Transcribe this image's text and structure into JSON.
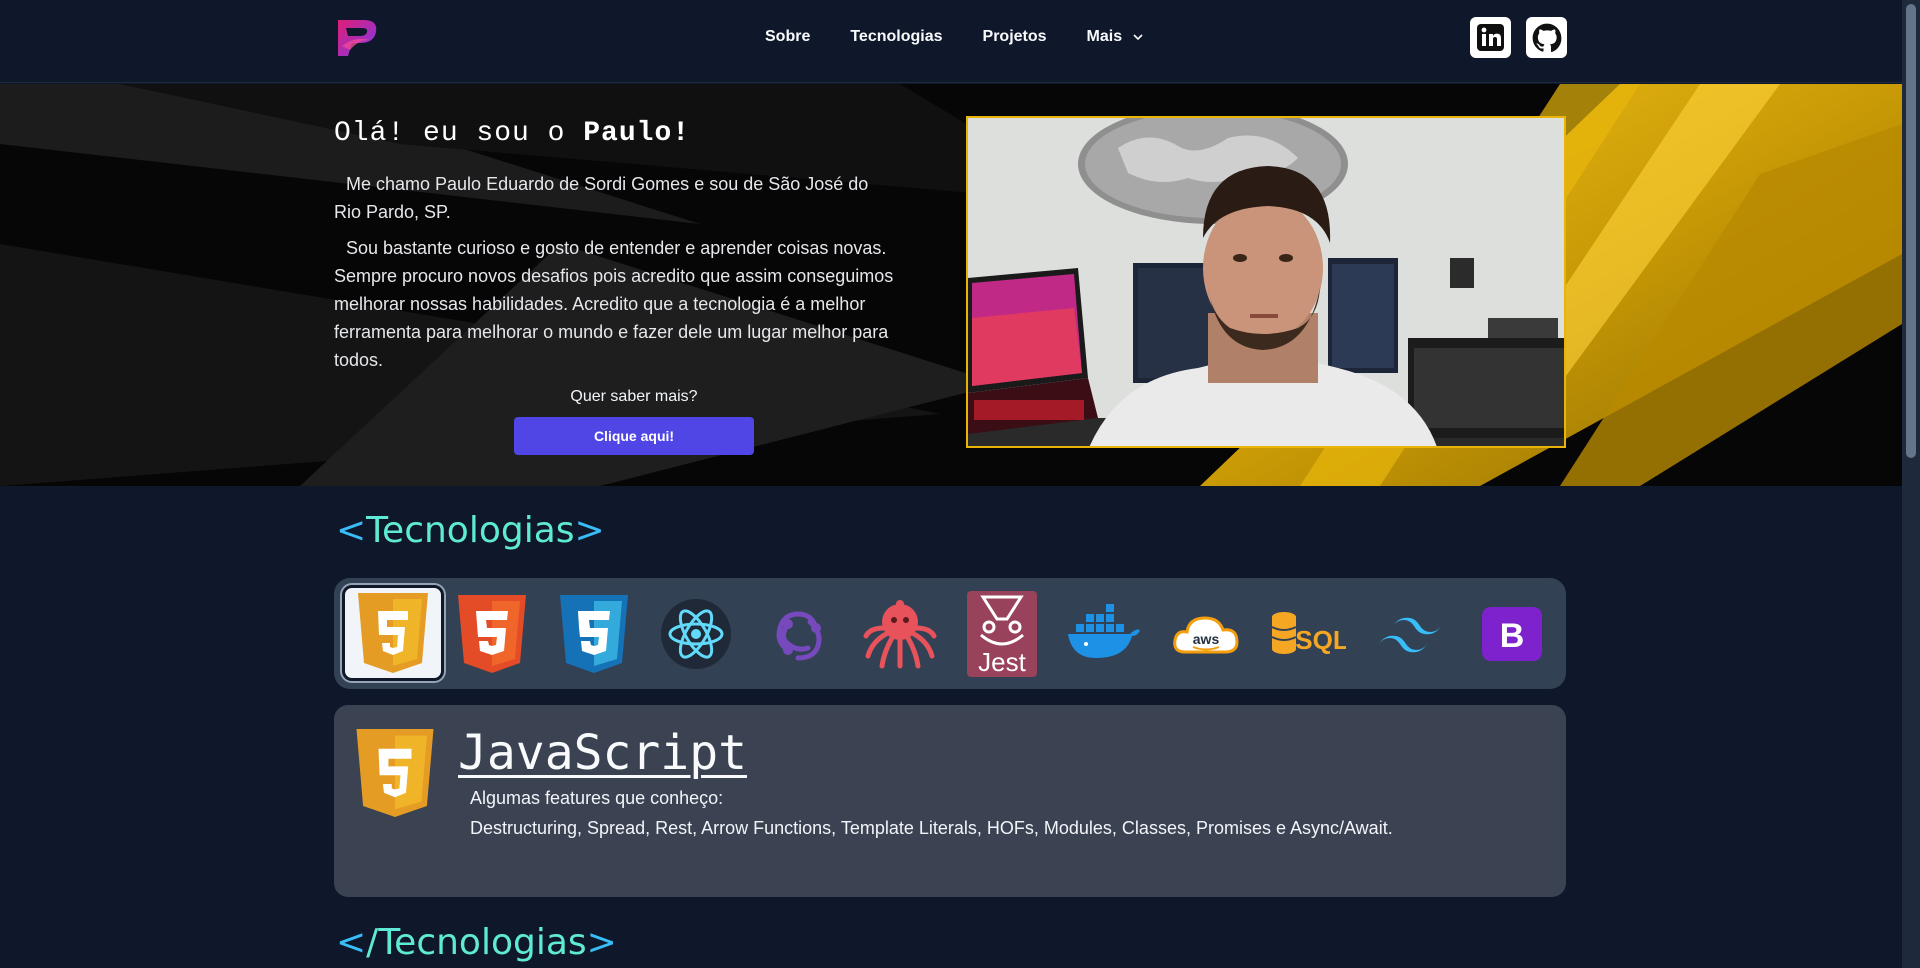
{
  "nav": {
    "links": [
      "Sobre",
      "Tecnologias",
      "Projetos",
      "Mais"
    ],
    "social": [
      {
        "name": "linkedin-icon",
        "label": "in"
      },
      {
        "name": "github-icon"
      }
    ]
  },
  "hero": {
    "greeting_prefix": "Olá! eu sou o ",
    "greeting_name": "Paulo!",
    "paragraph1": "Me chamo Paulo Eduardo de Sordi Gomes e sou de São José do Rio Pardo, SP.",
    "paragraph2": "Sou bastante curioso e gosto de entender e aprender coisas novas. Sempre procuro novos desafios pois acredito que assim conseguimos melhorar nossas habilidades. Acredito que a tecnologia é a melhor ferramenta para melhorar o mundo e fazer dele um lugar melhor para todos.",
    "more_label": "Quer saber mais?",
    "more_button": "Clique aqui!"
  },
  "tech": {
    "open_title": "Tecnologias",
    "close_title": "/Tecnologias",
    "bracket_open": "<",
    "bracket_close": ">",
    "icons": [
      "javascript-icon",
      "html5-icon",
      "css3-icon",
      "react-icon",
      "redux-icon",
      "git-icon",
      "jest-icon",
      "docker-icon",
      "aws-icon",
      "sql-icon",
      "tailwind-icon",
      "bootstrap-icon"
    ],
    "jest_label": "Jest",
    "aws_label": "aws",
    "sql_label": "SQL",
    "bootstrap_label": "B",
    "selected": {
      "name": "JavaScript",
      "subtitle": "Algumas features que conheço:",
      "description": "Destructuring, Spread, Rest, Arrow Functions, Template Literals, HOFs, Modules, Classes, Promises e Async/Await."
    }
  },
  "colors": {
    "background": "#0f172a",
    "accent": "#4f46e5",
    "gold": "#eab308",
    "title_teal": "#5eead4",
    "title_blue": "#38bdf8"
  }
}
